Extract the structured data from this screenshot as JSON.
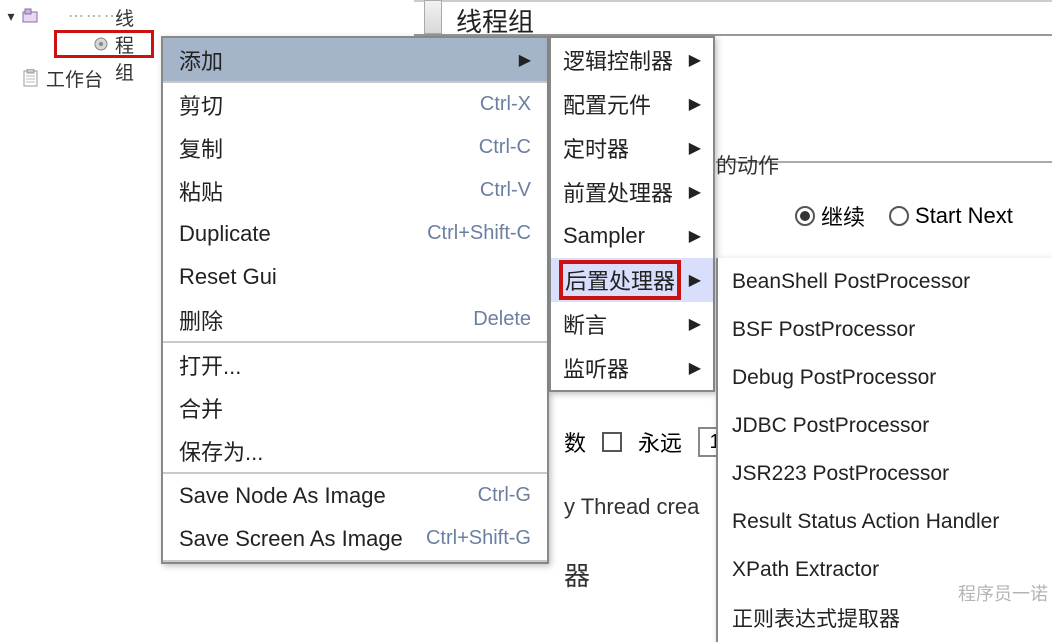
{
  "tree": {
    "node1_label": "线程组",
    "workbench_label": "工作台"
  },
  "panel": {
    "header_title": "线程组",
    "action_legend": "的动作",
    "radio_continue": "继续",
    "radio_startnext": "Start Next",
    "count_label_prefix": "数",
    "forever_label": "永远",
    "count_value": "1",
    "thread_create_text": "y Thread crea",
    "qi_label": "器"
  },
  "menu1": {
    "add": "添加",
    "cut": "剪切",
    "cut_key": "Ctrl-X",
    "copy": "复制",
    "copy_key": "Ctrl-C",
    "paste": "粘贴",
    "paste_key": "Ctrl-V",
    "duplicate": "Duplicate",
    "duplicate_key": "Ctrl+Shift-C",
    "reset": "Reset Gui",
    "delete": "删除",
    "delete_key": "Delete",
    "open": "打开...",
    "merge": "合并",
    "saveas": "保存为...",
    "savenode": "Save Node As Image",
    "savenode_key": "Ctrl-G",
    "savescreen": "Save Screen As Image",
    "savescreen_key": "Ctrl+Shift-G"
  },
  "menu2": {
    "logic": "逻辑控制器",
    "config": "配置元件",
    "timer": "定时器",
    "pre": "前置处理器",
    "sampler": "Sampler",
    "post": "后置处理器",
    "assert": "断言",
    "listener": "监听器"
  },
  "menu3": {
    "items": [
      "BeanShell PostProcessor",
      "BSF PostProcessor",
      "Debug PostProcessor",
      "JDBC PostProcessor",
      "JSR223 PostProcessor",
      "Result Status Action Handler",
      "XPath Extractor",
      "正则表达式提取器"
    ]
  },
  "watermark": "程序员一诺"
}
